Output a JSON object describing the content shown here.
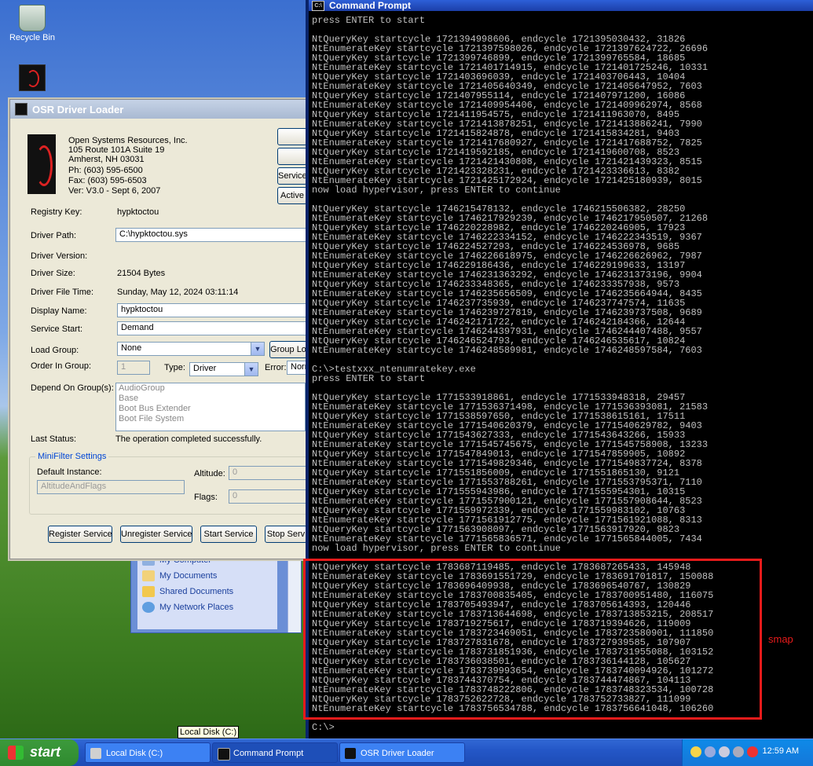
{
  "desktop": {
    "icons": [
      {
        "label": "Recycle Bin"
      },
      {
        "label": "OSRLOADER"
      }
    ]
  },
  "explorer": {
    "items": [
      "My Computer",
      "My Documents",
      "Shared Documents",
      "My Network Places"
    ]
  },
  "osr": {
    "title": "OSR Driver Loader",
    "company": [
      "Open Systems Resources, Inc.",
      "105 Route 101A Suite 19",
      "Amherst, NH 03031",
      "Ph:  (603) 595-6500",
      "Fax: (603) 595-6503",
      "Ver: V3.0  -  Sept 6, 2007"
    ],
    "side_buttons": [
      "",
      "",
      "Service",
      "Active"
    ],
    "registry_key_label": "Registry Key:",
    "registry_key": "hypktoctou",
    "driver_path_label": "Driver Path:",
    "driver_path": "C:\\hypktoctou.sys",
    "driver_version_label": "Driver Version:",
    "driver_size_label": "Driver Size:",
    "driver_size": "21504 Bytes",
    "driver_file_time_label": "Driver File Time:",
    "driver_file_time": "Sunday, May 12, 2024 03:11:14",
    "display_name_label": "Display Name:",
    "display_name": "hypktoctou",
    "service_start_label": "Service Start:",
    "service_start": "Demand",
    "load_group_label": "Load Group:",
    "load_group": "None",
    "group_button": "Group Lo",
    "order_in_group_label": "Order In Group:",
    "order_in_group": "1",
    "type_label": "Type:",
    "type": "Driver",
    "error_label": "Error:",
    "error": "Norm",
    "depend_label": "Depend On Group(s):",
    "depend_groups": [
      "AudioGroup",
      "Base",
      "Boot Bus Extender",
      "Boot File System"
    ],
    "last_status_label": "Last Status:",
    "last_status": "The operation completed successfully.",
    "minifilter_title": "MiniFilter Settings",
    "default_instance_label": "Default Instance:",
    "default_instance": "AltitudeAndFlags",
    "altitude_label": "Altitude:",
    "altitude": "0",
    "flags_label": "Flags:",
    "flags": "0",
    "buttons": [
      "Register Service",
      "Unregister Service",
      "Start Service",
      "Stop Serv"
    ]
  },
  "cmd": {
    "title": "Command Prompt",
    "icon_text": "C:\\",
    "lines": [
      "press ENTER to start",
      "",
      "NtQueryKey startcycle 1721394998606, endcycle 1721395030432, 31826",
      "NtEnumerateKey startcycle 1721397598026, endcycle 1721397624722, 26696",
      "NtQueryKey startcycle 1721399746899, endcycle 1721399765584, 18685",
      "NtEnumerateKey startcycle 1721401714915, endcycle 1721401725246, 10331",
      "NtQueryKey startcycle 1721403696039, endcycle 1721403706443, 10404",
      "NtEnumerateKey startcycle 1721405640349, endcycle 1721405647952, 7603",
      "NtQueryKey startcycle 1721407955114, endcycle 1721407971200, 16086",
      "NtEnumerateKey startcycle 1721409954406, endcycle 1721409962974, 8568",
      "NtQueryKey startcycle 1721411954575, endcycle 1721411963070, 8495",
      "NtEnumerateKey startcycle 1721413878251, endcycle 1721413886241, 7990",
      "NtQueryKey startcycle 1721415824878, endcycle 1721415834281, 9403",
      "NtEnumerateKey startcycle 1721417680927, endcycle 1721417688752, 7825",
      "NtQueryKey startcycle 1721419592185, endcycle 1721419600708, 8523",
      "NtEnumerateKey startcycle 1721421430808, endcycle 1721421439323, 8515",
      "NtQueryKey startcycle 1721423328231, endcycle 1721423336613, 8382",
      "NtEnumerateKey startcycle 1721425172924, endcycle 1721425180939, 8015",
      "now load hypervisor, press ENTER to continue",
      "",
      "NtQueryKey startcycle 1746215478132, endcycle 1746215506382, 28250",
      "NtEnumerateKey startcycle 1746217929239, endcycle 1746217950507, 21268",
      "NtQueryKey startcycle 1746220228982, endcycle 1746220246905, 17923",
      "NtEnumerateKey startcycle 1746222334152, endcycle 1746222343519, 9367",
      "NtQueryKey startcycle 1746224527293, endcycle 1746224536978, 9685",
      "NtEnumerateKey startcycle 1746226618975, endcycle 1746226626962, 7987",
      "NtQueryKey startcycle 1746229186436, endcycle 1746229199633, 13197",
      "NtEnumerateKey startcycle 1746231363292, endcycle 1746231373196, 9904",
      "NtQueryKey startcycle 1746233348365, endcycle 1746233357938, 9573",
      "NtEnumerateKey startcycle 1746235656509, endcycle 1746235664944, 8435",
      "NtQueryKey startcycle 1746237735939, endcycle 1746237747574, 11635",
      "NtEnumerateKey startcycle 1746239727819, endcycle 1746239737508, 9689",
      "NtQueryKey startcycle 1746242171722, endcycle 1746242184366, 12644",
      "NtEnumerateKey startcycle 1746244397931, endcycle 1746244407488, 9557",
      "NtQueryKey startcycle 1746246524793, endcycle 1746246535617, 10824",
      "NtEnumerateKey startcycle 1746248589981, endcycle 1746248597584, 7603",
      "",
      "C:\\>testxxx_ntenumratekey.exe",
      "press ENTER to start",
      "",
      "NtQueryKey startcycle 1771533918861, endcycle 1771533948318, 29457",
      "NtEnumerateKey startcycle 1771536371498, endcycle 1771536393081, 21583",
      "NtQueryKey startcycle 1771538597650, endcycle 1771538615161, 17511",
      "NtEnumerateKey startcycle 1771540620379, endcycle 1771540629782, 9403",
      "NtQueryKey startcycle 1771543627333, endcycle 1771543643266, 15933",
      "NtEnumerateKey startcycle 1771545745675, endcycle 1771545758908, 13233",
      "NtQueryKey startcycle 1771547849013, endcycle 1771547859905, 10892",
      "NtEnumerateKey startcycle 1771549829346, endcycle 1771549837724, 8378",
      "NtQueryKey startcycle 1771551856009, endcycle 1771551865130, 9121",
      "NtEnumerateKey startcycle 1771553788261, endcycle 1771553795371, 7110",
      "NtQueryKey startcycle 1771555943986, endcycle 1771555954301, 10315",
      "NtEnumerateKey startcycle 1771557900121, endcycle 1771557908644, 8523",
      "NtQueryKey startcycle 1771559972339, endcycle 1771559983102, 10763",
      "NtEnumerateKey startcycle 1771561912775, endcycle 1771561921088, 8313",
      "NtQueryKey startcycle 1771563908097, endcycle 1771563917920, 9823",
      "NtEnumerateKey startcycle 1771565836571, endcycle 1771565844005, 7434",
      "now load hypervisor, press ENTER to continue",
      "",
      "NtQueryKey startcycle 1783687119485, endcycle 1783687265433, 145948",
      "NtEnumerateKey startcycle 1783691551729, endcycle 1783691701817, 150088",
      "NtQueryKey startcycle 1783696409938, endcycle 1783696540767, 130829",
      "NtEnumerateKey startcycle 1783700835405, endcycle 1783700951480, 116075",
      "NtQueryKey startcycle 1783705493947, endcycle 1783705614393, 120446",
      "NtEnumerateKey startcycle 1783713644698, endcycle 1783713853215, 208517",
      "NtQueryKey startcycle 1783719275617, endcycle 1783719394626, 119009",
      "NtEnumerateKey startcycle 1783723469051, endcycle 1783723580901, 111850",
      "NtQueryKey startcycle 1783727831678, endcycle 1783727939585, 107907",
      "NtEnumerateKey startcycle 1783731851936, endcycle 1783731955088, 103152",
      "NtQueryKey startcycle 1783736038501, endcycle 1783736144128, 105627",
      "NtEnumerateKey startcycle 1783739993654, endcycle 1783740094926, 101272",
      "NtQueryKey startcycle 1783744370754, endcycle 1783744474867, 104113",
      "NtEnumerateKey startcycle 1783748222806, endcycle 1783748323534, 100728",
      "NtQueryKey startcycle 1783752622728, endcycle 1783752733827, 111099",
      "NtEnumerateKey startcycle 1783756534788, endcycle 1783756641048, 106260",
      "",
      "C:\\>"
    ]
  },
  "annotation": {
    "label": "smap",
    "color": "#e81b1b"
  },
  "tooltip": "Local Disk (C:)",
  "taskbar": {
    "start_label": "start",
    "tasks": [
      "Local Disk (C:)",
      "Command Prompt",
      "OSR Driver Loader"
    ],
    "clock": "12:59 AM"
  }
}
